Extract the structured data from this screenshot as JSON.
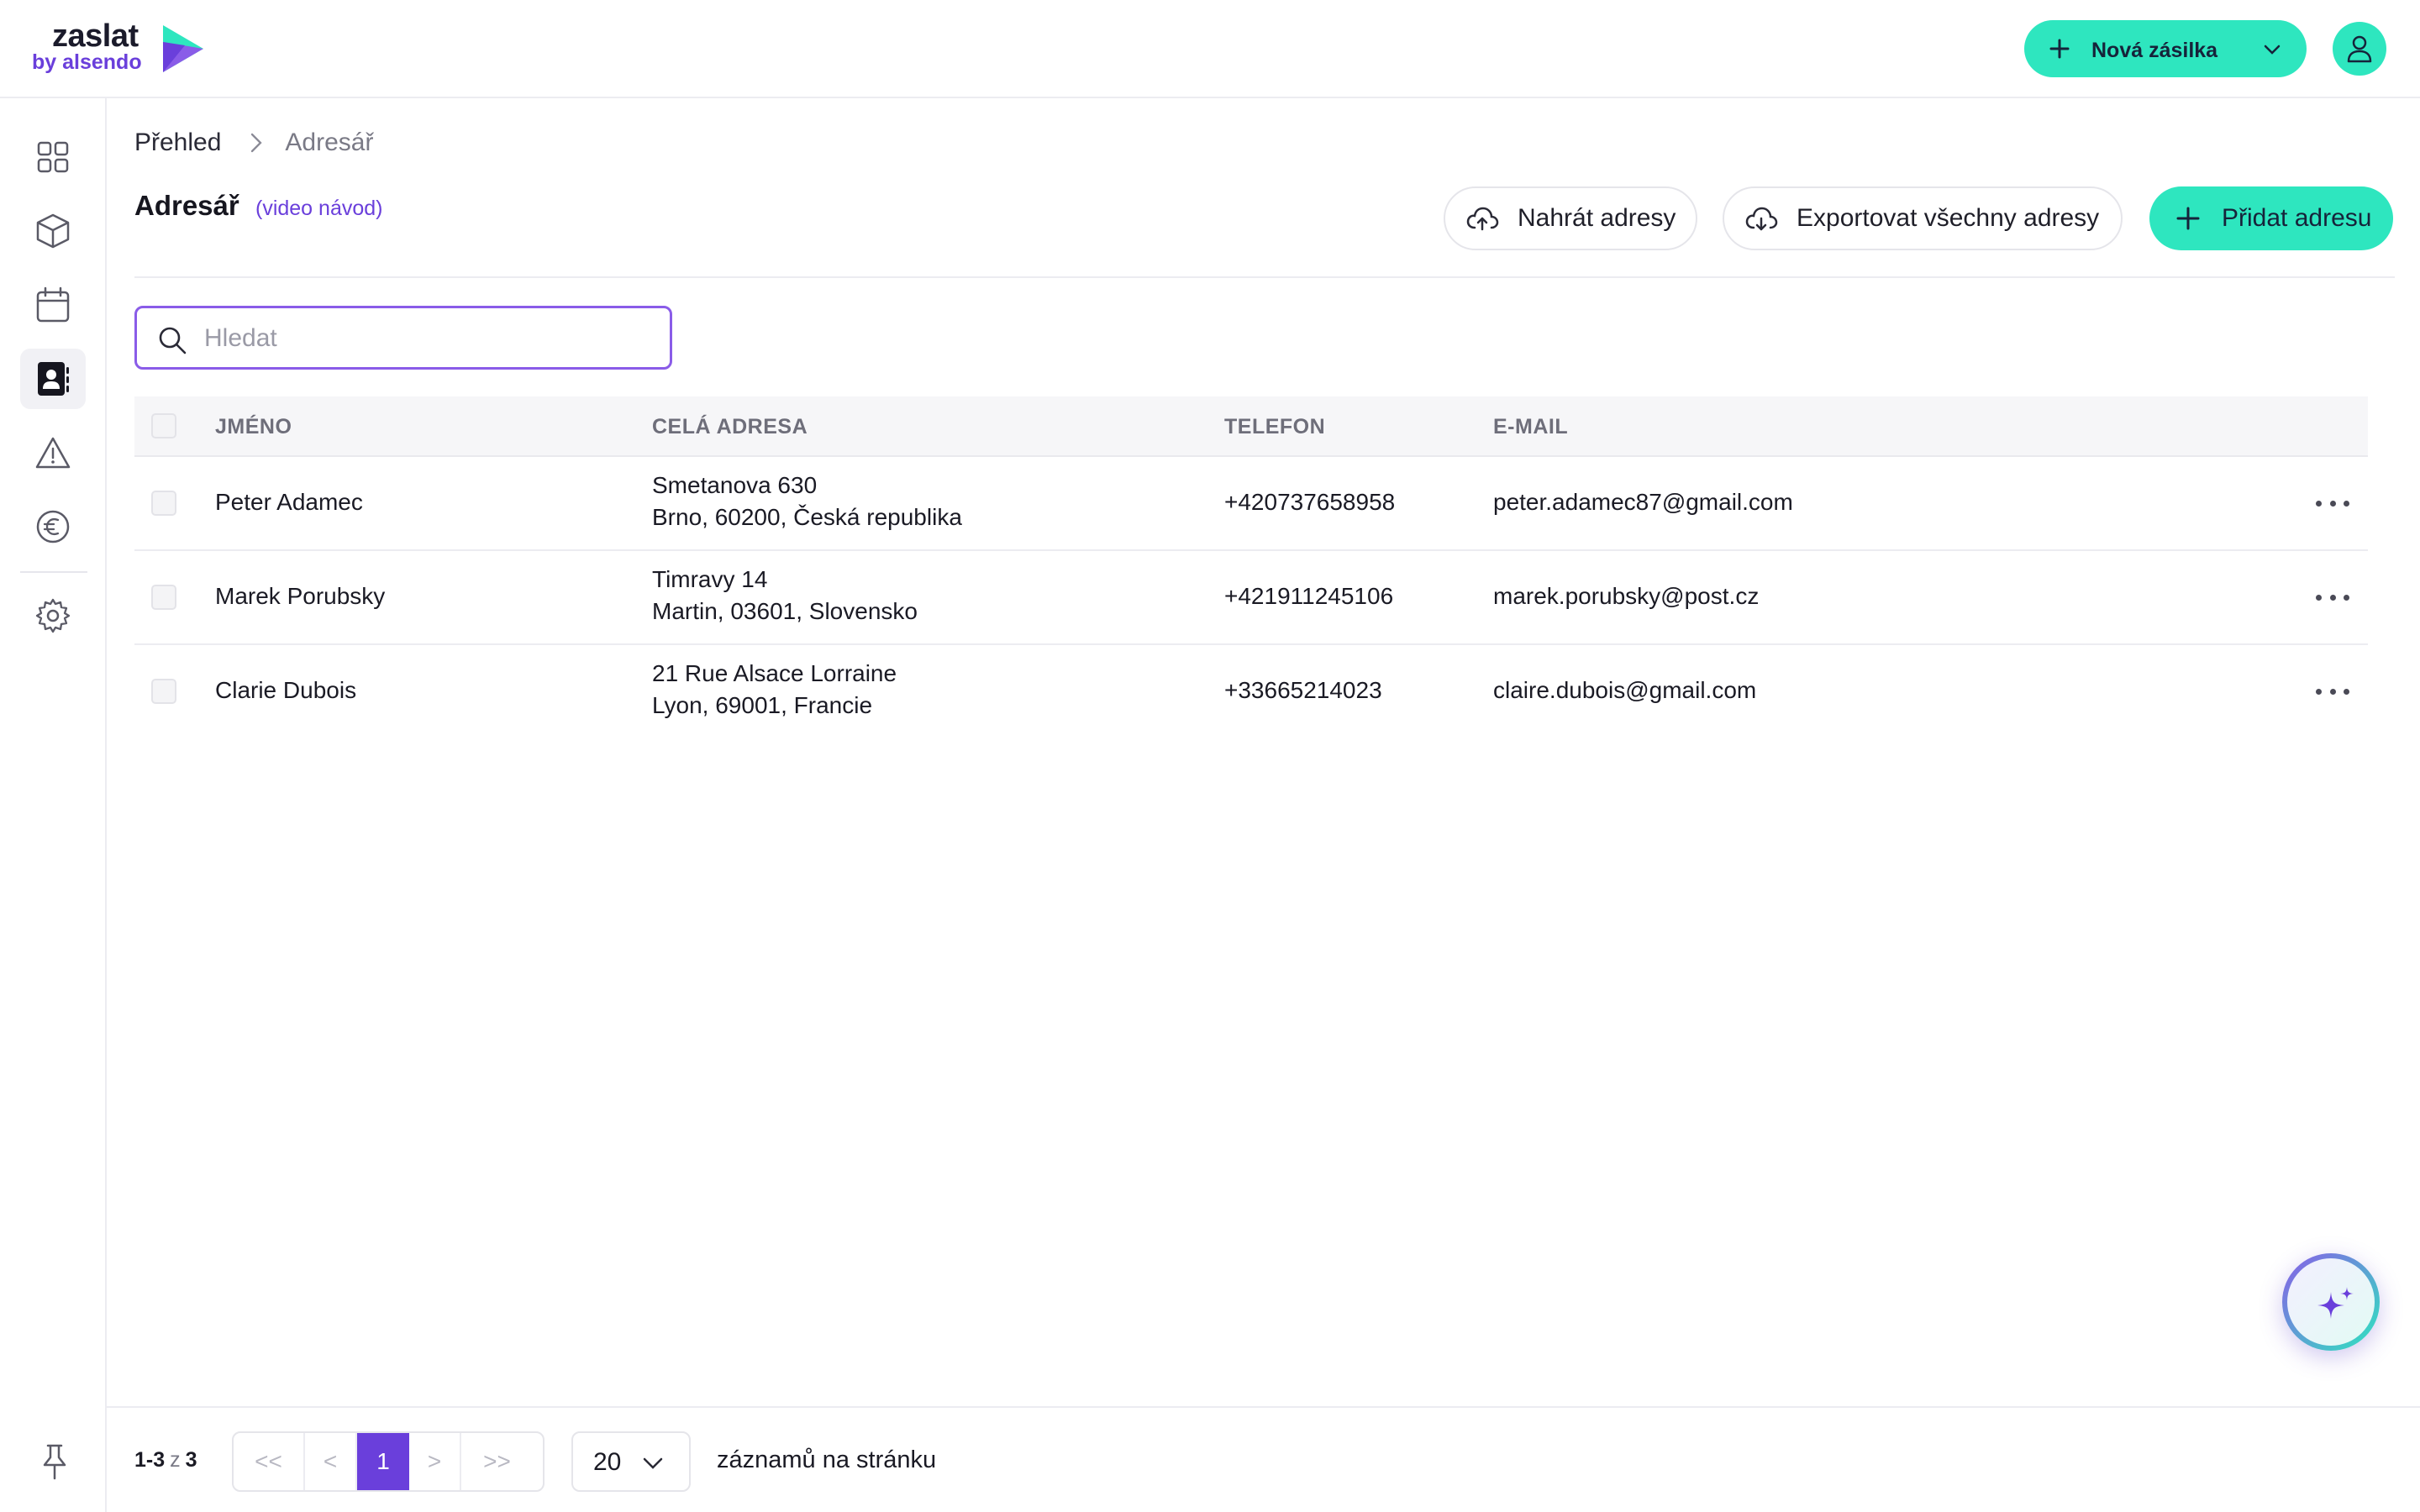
{
  "header": {
    "logo_name": "zaslat",
    "logo_sub": "by alsendo",
    "new_shipment_label": "Nová zásilka"
  },
  "sidebar": {
    "items": [
      {
        "icon": "dashboard-grid-icon"
      },
      {
        "icon": "package-box-icon"
      },
      {
        "icon": "calendar-icon"
      },
      {
        "icon": "address-book-icon",
        "active": true
      },
      {
        "icon": "warning-triangle-icon"
      },
      {
        "icon": "euro-coin-icon"
      },
      {
        "icon": "gear-icon"
      }
    ],
    "pin_icon": "pin-icon"
  },
  "breadcrumb": {
    "home": "Přehled",
    "current": "Adresář"
  },
  "page": {
    "title": "Adresář",
    "video_link": "(video návod)"
  },
  "actions": {
    "upload_label": "Nahrát adresy",
    "export_label": "Exportovat všechny adresy",
    "add_label": "Přidat adresu"
  },
  "search": {
    "placeholder": "Hledat",
    "value": ""
  },
  "table": {
    "columns": [
      "JMÉNO",
      "CELÁ ADRESA",
      "TELEFON",
      "E-MAIL"
    ],
    "rows": [
      {
        "name": "Peter Adamec",
        "address_line1": "Smetanova 630",
        "address_line2": "Brno, 60200, Česká republika",
        "phone": "+420737658958",
        "email": "peter.adamec87@gmail.com"
      },
      {
        "name": "Marek Porubsky",
        "address_line1": "Timravy 14",
        "address_line2": "Martin, 03601, Slovensko",
        "phone": "+421911245106",
        "email": "marek.porubsky@post.cz"
      },
      {
        "name": "Clarie Dubois",
        "address_line1": "21 Rue Alsace Lorraine",
        "address_line2": "Lyon, 69001, Francie",
        "phone": "+33665214023",
        "email": "claire.dubois@gmail.com"
      }
    ]
  },
  "pagination": {
    "range": "1-3",
    "of": "z",
    "total": "3",
    "first": "<<",
    "prev": "<",
    "current_page": "1",
    "next": ">",
    "last": ">>",
    "per_page": "20",
    "per_page_label": "záznamů na stránku"
  },
  "colors": {
    "accent_green": "#2ee6bf",
    "brand_purple": "#6a3fdb"
  }
}
